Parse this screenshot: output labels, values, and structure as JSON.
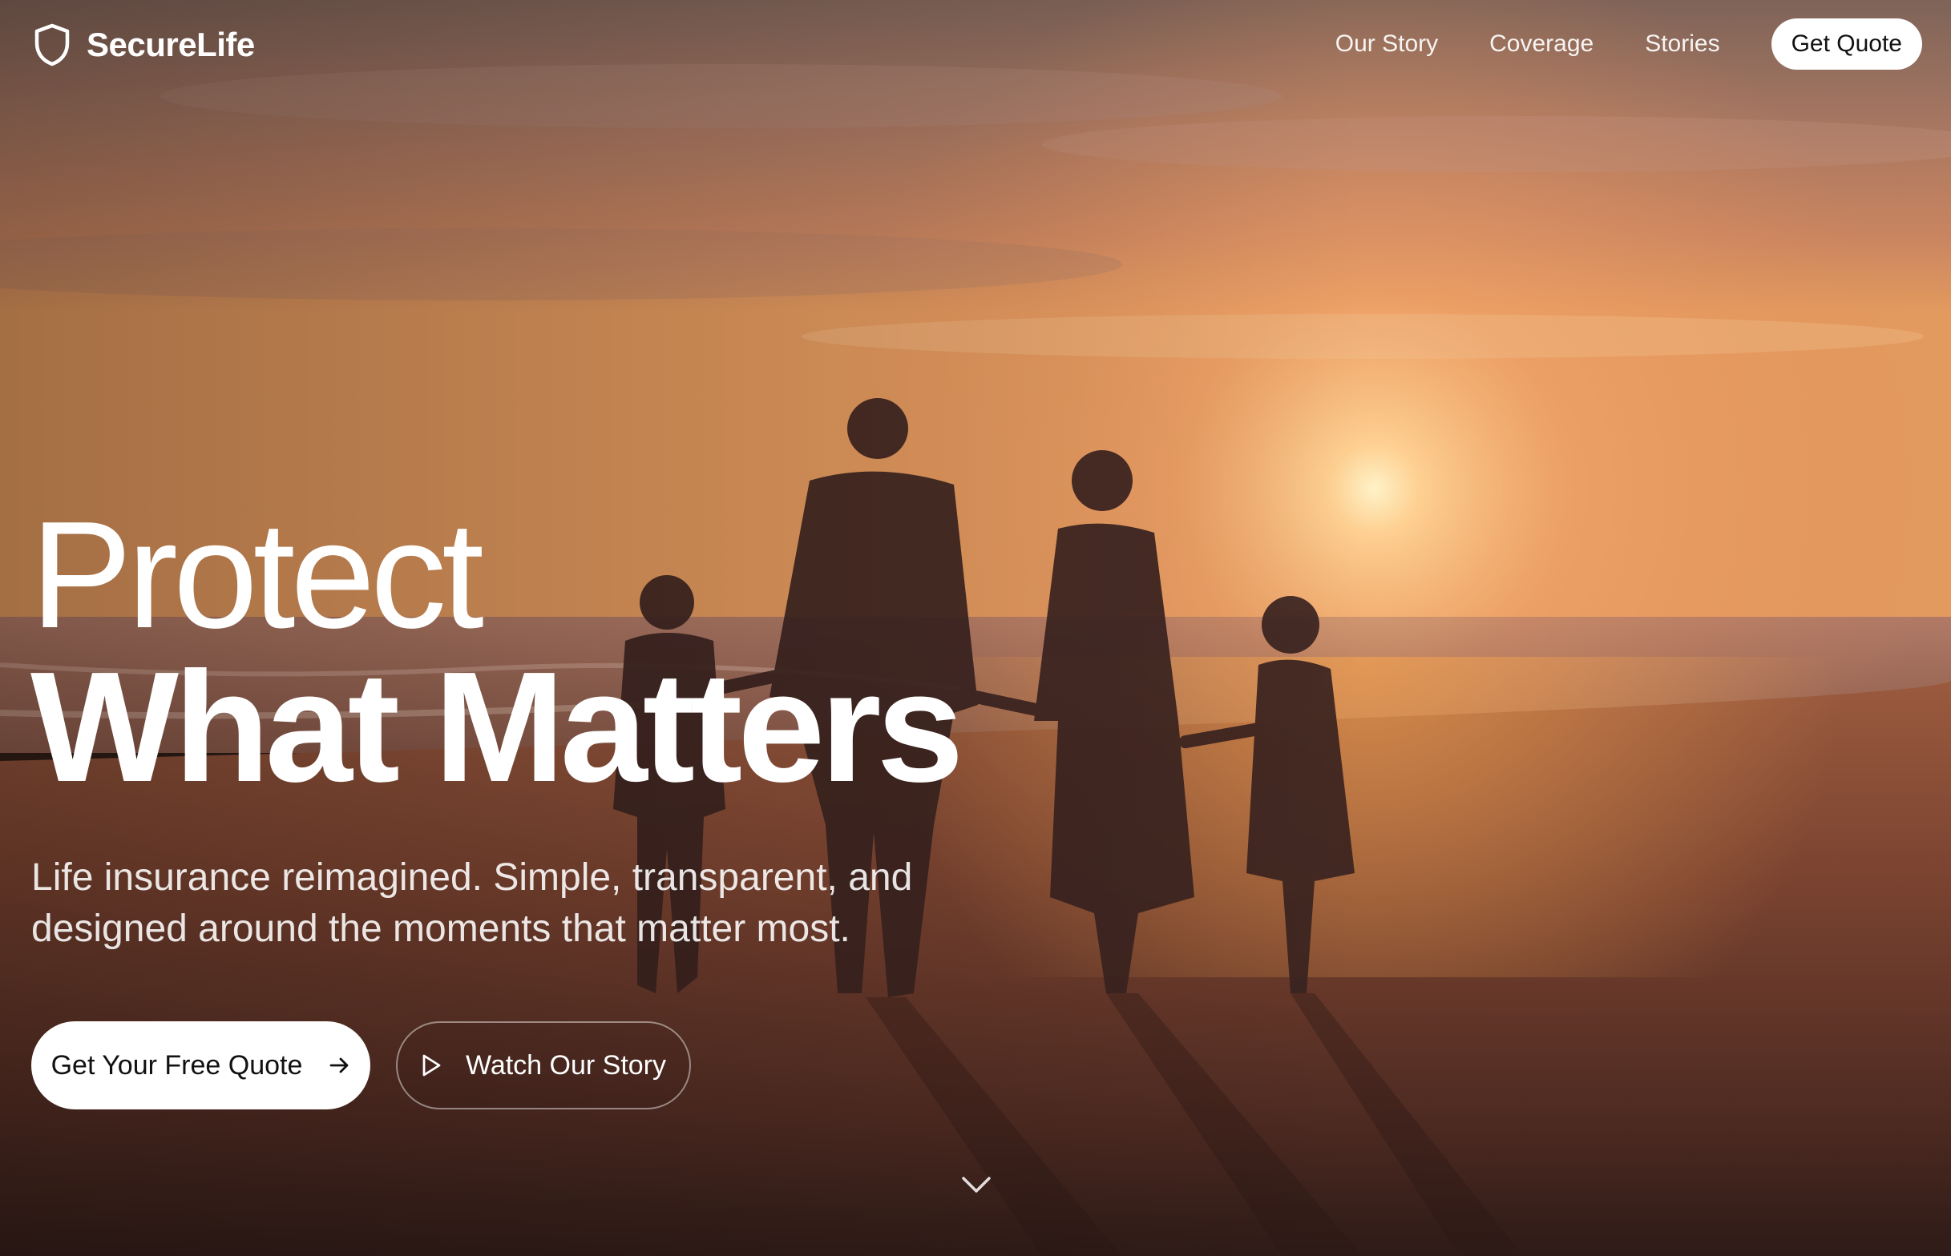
{
  "nav": {
    "brand": "SecureLife",
    "links": [
      "Our Story",
      "Coverage",
      "Stories"
    ],
    "cta": "Get Quote"
  },
  "hero": {
    "headline_line1": "Protect",
    "headline_line2": "What Matters",
    "subtitle_line1": "Life insurance reimagined. Simple, transparent, and",
    "subtitle_line2": "designed around the moments that matter most.",
    "primary_button": "Get Your Free Quote",
    "secondary_button": "Watch Our Story",
    "background_image": "family-walking-on-beach-at-sunset"
  },
  "icons": {
    "logo": "shield-icon",
    "primary_button": "arrow-right-icon",
    "secondary_button": "play-icon",
    "scroll": "chevron-down-icon"
  },
  "colors": {
    "sky_top": "#8a6a5c",
    "sky_mid": "#d9895a",
    "sun": "#ffe0a0",
    "sand": "#6e3f2c",
    "primary_button_bg": "#ffffff",
    "text": "#ffffff"
  }
}
